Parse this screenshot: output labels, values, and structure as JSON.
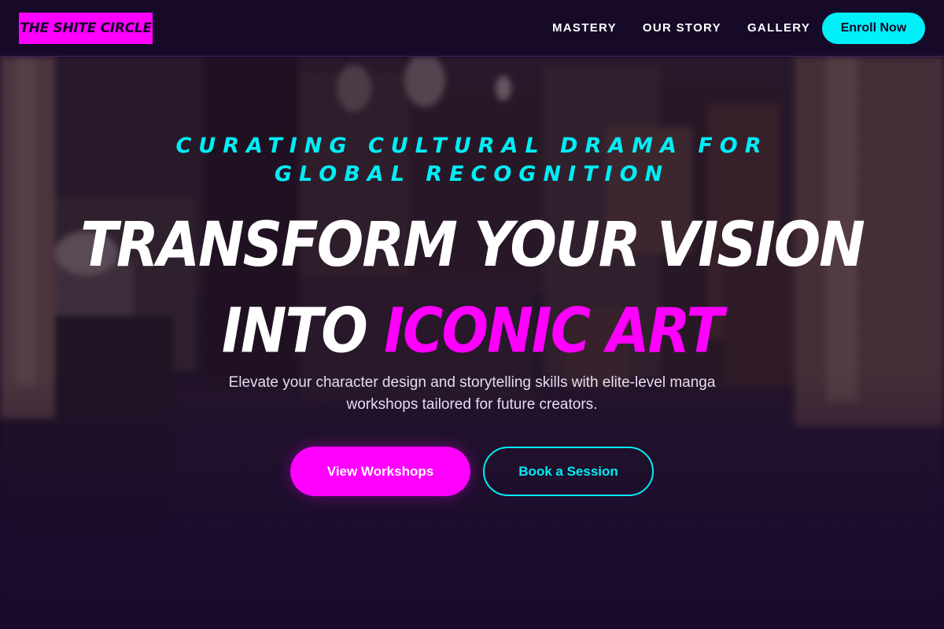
{
  "nav": {
    "logo": "THE SHITE CIRCLE",
    "links": [
      "MASTERY",
      "OUR STORY",
      "GALLERY"
    ],
    "cta_label": "Enroll Now"
  },
  "hero": {
    "tagline": "CURATING CULTURAL DRAMA FOR GLOBAL RECOGNITION",
    "headline_line1": "TRANSFORM YOUR VISION",
    "headline_line2_prefix": "INTO ",
    "headline_line2_accent": "ICONIC ART",
    "subtitle": "Elevate your character design and storytelling skills with elite-level manga workshops tailored for future creators.",
    "primary_button": "View Workshops",
    "secondary_button": "Book a Session"
  },
  "colors": {
    "background": "#1a0a2e",
    "magenta_accent": "#ff00ff",
    "cyan_accent": "#00eef5",
    "navbar": "#170a28"
  }
}
